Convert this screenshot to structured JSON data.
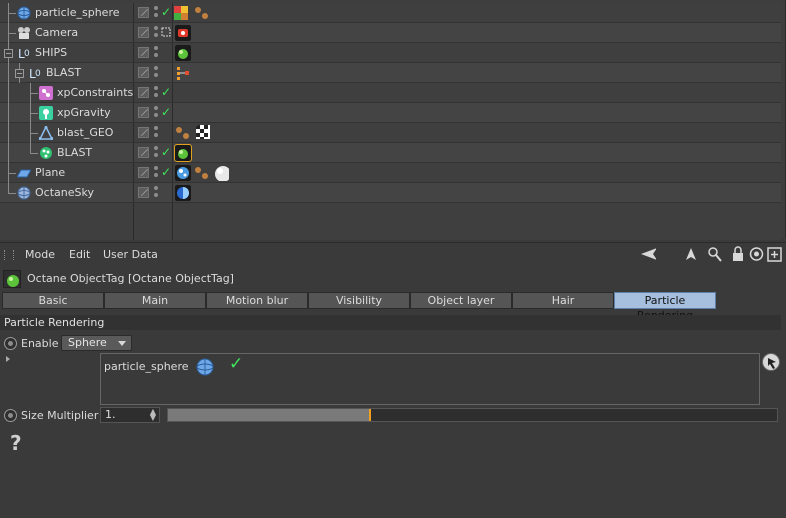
{
  "object_manager": {
    "objects": [
      {
        "name": "particle_sphere",
        "icon": "sphere-icon",
        "check": true
      },
      {
        "name": "Camera",
        "icon": "camera-icon",
        "check": false
      },
      {
        "name": "SHIPS",
        "icon": "null-icon",
        "check": false
      },
      {
        "name": "BLAST",
        "icon": "null-icon",
        "check": false
      },
      {
        "name": "xpConstraints",
        "icon": "xp-constraints-icon",
        "check": true
      },
      {
        "name": "xpGravity",
        "icon": "xp-gravity-icon",
        "check": true
      },
      {
        "name": "blast_GEO",
        "icon": "geometry-icon",
        "check": false
      },
      {
        "name": "BLAST",
        "icon": "xp-emitter-icon",
        "check": true
      },
      {
        "name": "Plane",
        "icon": "plane-icon",
        "check": true
      },
      {
        "name": "OctaneSky",
        "icon": "sky-icon",
        "check": false
      }
    ]
  },
  "attribute_manager": {
    "menu": [
      "Mode",
      "Edit",
      "User Data"
    ],
    "tag_title": "Octane ObjectTag [Octane ObjectTag]",
    "tabs": [
      "Basic",
      "Main",
      "Motion blur",
      "Visibility",
      "Object layer",
      "Hair",
      "Particle Rendering"
    ],
    "active_tab": "Particle Rendering",
    "section_title": "Particle Rendering",
    "enable_label": "Enable",
    "enable_value": "Sphere",
    "list_item": "particle_sphere",
    "size_label": "Size Multiplier",
    "size_value": "1.",
    "size_slider_fraction": 0.33,
    "help_glyph": "?"
  },
  "colors": {
    "check": "#3ee65a",
    "active_tab": "#a6bfde",
    "slider_handle": "#f0a020"
  }
}
